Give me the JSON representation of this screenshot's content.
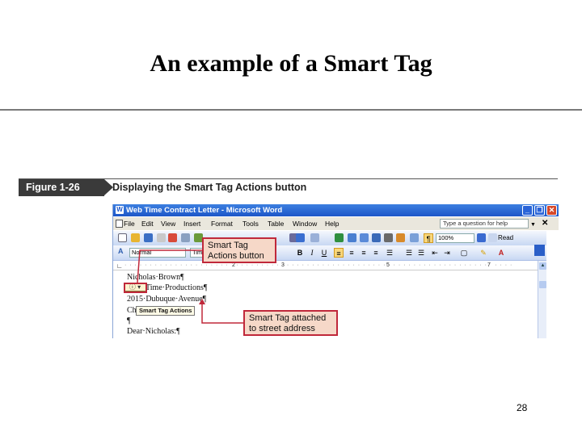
{
  "slide": {
    "title": "An example of a Smart Tag",
    "page_number": "28"
  },
  "figure": {
    "label": "Figure 1-26",
    "caption": "Displaying the Smart Tag Actions button"
  },
  "window": {
    "title": "Web Time Contract Letter - Microsoft Word",
    "app_icon": "W",
    "minimize": "_",
    "restore": "❐",
    "close": "✕"
  },
  "menu": {
    "items": [
      "File",
      "Edit",
      "View",
      "Insert",
      "Format",
      "Tools",
      "Table",
      "Window",
      "Help"
    ],
    "help_placeholder": "Type a question for help",
    "close": "✕"
  },
  "toolbar": {
    "zoom": "100%",
    "read": "Read",
    "style": "Normal",
    "font": "Tim",
    "bold": "B",
    "italic": "I",
    "underline": "U",
    "pilcrow": "¶"
  },
  "ruler": {
    "marks": [
      "2",
      "3",
      "5",
      "7"
    ]
  },
  "document": {
    "lines": [
      "Nicholas·Brown¶",
      "Time·Productions¶",
      "2015·Dubuque·Avenue¶",
      "Ch",
      "¶",
      "Dear·Nicholas:¶"
    ],
    "smart_tag_tooltip": "Smart Tag Actions"
  },
  "callouts": {
    "actions_button": "Smart Tag Actions button",
    "attached": "Smart Tag attached to street address"
  },
  "colors": {
    "callout_border": "#c0283a",
    "callout_fill": "#f6d8c8",
    "titlebar": "#1d56c8"
  }
}
